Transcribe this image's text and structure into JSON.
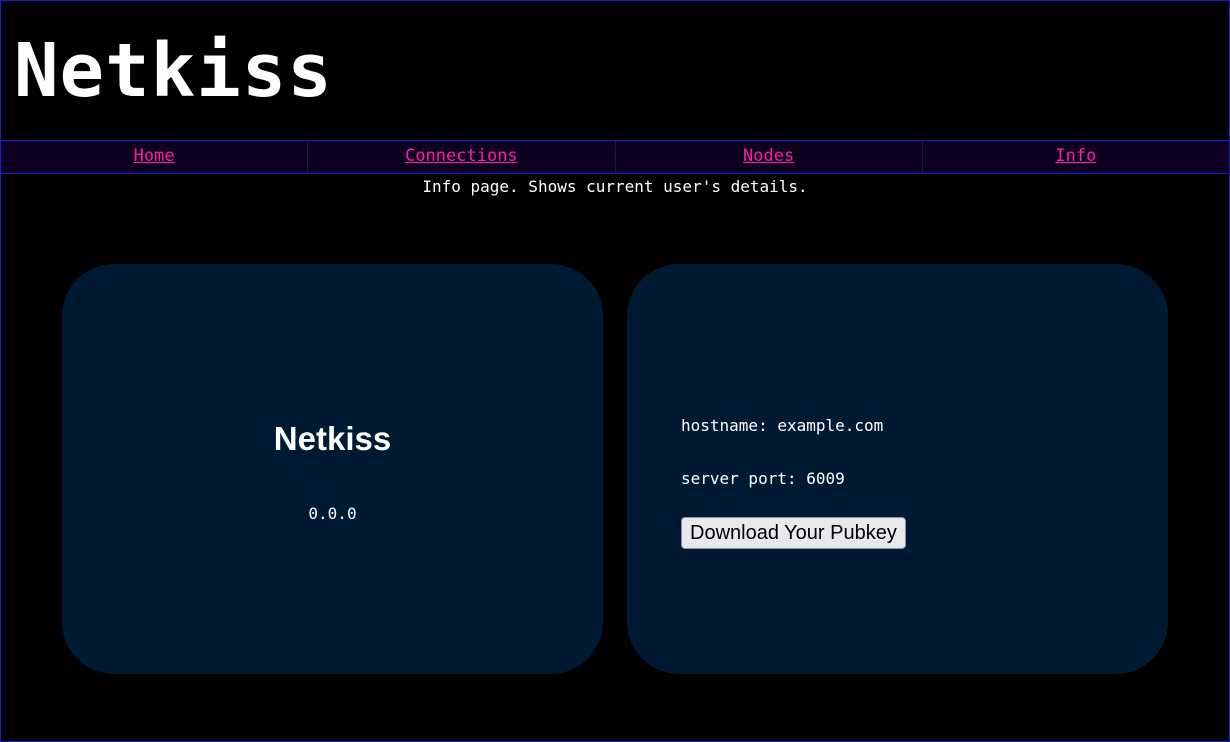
{
  "site": {
    "title": "Netkiss"
  },
  "nav": {
    "items": [
      {
        "label": "Home"
      },
      {
        "label": "Connections"
      },
      {
        "label": "Nodes"
      },
      {
        "label": "Info"
      }
    ]
  },
  "page": {
    "description": "Info page. Shows current user's details."
  },
  "app_card": {
    "name": "Netkiss",
    "version": "0.0.0"
  },
  "server_card": {
    "hostname_line": "hostname: example.com",
    "port_line": "server port: 6009",
    "download_button_label": "Download Your Pubkey"
  },
  "colors": {
    "background": "#000000",
    "nav_background": "#0d0020",
    "border_accent": "#1c1cc8",
    "link": "#ff1aa8",
    "card_background": "#001a33",
    "text": "#ffffff"
  }
}
